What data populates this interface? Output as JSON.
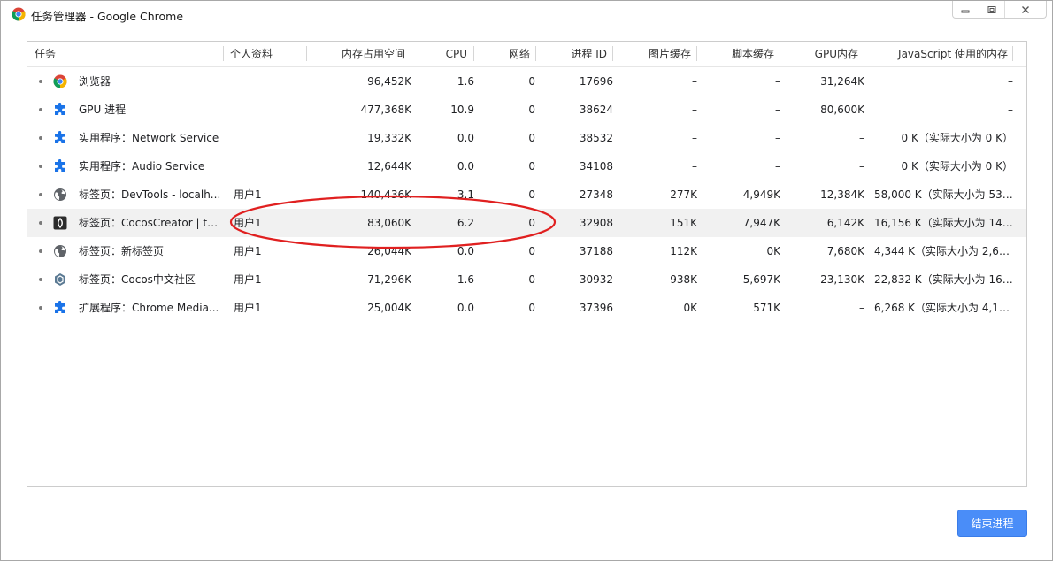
{
  "window": {
    "title": "任务管理器 - Google Chrome"
  },
  "header": {
    "columns": [
      "任务",
      "个人资料",
      "内存占用空间",
      "CPU",
      "网络",
      "进程 ID",
      "图片缓存",
      "脚本缓存",
      "GPU内存",
      "JavaScript 使用的内存"
    ]
  },
  "rows": [
    {
      "task": "浏览器",
      "icon": "chrome-icon",
      "profile": "",
      "memory": "96,452K",
      "cpu": "1.6",
      "network": "0",
      "pid": "17696",
      "image_cache": "–",
      "script_cache": "–",
      "gpu_memory": "31,264K",
      "js_memory": "–",
      "selected": false
    },
    {
      "task": "GPU 进程",
      "icon": "puzzle-icon",
      "profile": "",
      "memory": "477,368K",
      "cpu": "10.9",
      "network": "0",
      "pid": "38624",
      "image_cache": "–",
      "script_cache": "–",
      "gpu_memory": "80,600K",
      "js_memory": "–",
      "selected": false
    },
    {
      "task": "实用程序：Network Service",
      "icon": "puzzle-icon",
      "profile": "",
      "memory": "19,332K",
      "cpu": "0.0",
      "network": "0",
      "pid": "38532",
      "image_cache": "–",
      "script_cache": "–",
      "gpu_memory": "–",
      "js_memory": "0 K（实际大小为 0 K）",
      "selected": false
    },
    {
      "task": "实用程序：Audio Service",
      "icon": "puzzle-icon",
      "profile": "",
      "memory": "12,644K",
      "cpu": "0.0",
      "network": "0",
      "pid": "34108",
      "image_cache": "–",
      "script_cache": "–",
      "gpu_memory": "–",
      "js_memory": "0 K（实际大小为 0 K）",
      "selected": false
    },
    {
      "task": "标签页：DevTools - localh...",
      "icon": "globe-icon",
      "profile": "用户1",
      "memory": "140,436K",
      "cpu": "3.1",
      "network": "0",
      "pid": "27348",
      "image_cache": "277K",
      "script_cache": "4,949K",
      "gpu_memory": "12,384K",
      "js_memory": "58,000 K（实际大小为 53,...",
      "selected": false
    },
    {
      "task": "标签页：CocosCreator | tes...",
      "icon": "cocos-icon",
      "profile": "用户1",
      "memory": "83,060K",
      "cpu": "6.2",
      "network": "0",
      "pid": "32908",
      "image_cache": "151K",
      "script_cache": "7,947K",
      "gpu_memory": "6,142K",
      "js_memory": "16,156 K（实际大小为 14,...",
      "selected": true
    },
    {
      "task": "标签页：新标签页",
      "icon": "globe-icon",
      "profile": "用户1",
      "memory": "26,044K",
      "cpu": "0.0",
      "network": "0",
      "pid": "37188",
      "image_cache": "112K",
      "script_cache": "0K",
      "gpu_memory": "7,680K",
      "js_memory": "4,344 K（实际大小为 2,60...",
      "selected": false
    },
    {
      "task": "标签页：Cocos中文社区",
      "icon": "cocos-community-icon",
      "profile": "用户1",
      "memory": "71,296K",
      "cpu": "1.6",
      "network": "0",
      "pid": "30932",
      "image_cache": "938K",
      "script_cache": "5,697K",
      "gpu_memory": "23,130K",
      "js_memory": "22,832 K（实际大小为 16,...",
      "selected": false
    },
    {
      "task": "扩展程序：Chrome Media...",
      "icon": "puzzle-icon",
      "profile": "用户1",
      "memory": "25,004K",
      "cpu": "0.0",
      "network": "0",
      "pid": "37396",
      "image_cache": "0K",
      "script_cache": "571K",
      "gpu_memory": "–",
      "js_memory": "6,268 K（实际大小为 4,13...",
      "selected": false
    }
  ],
  "footer": {
    "end_process_label": "结束进程"
  },
  "colors": {
    "accent": "#4a8df8",
    "annotation": "#e02020",
    "puzzle_icon": "#1a73e8"
  }
}
